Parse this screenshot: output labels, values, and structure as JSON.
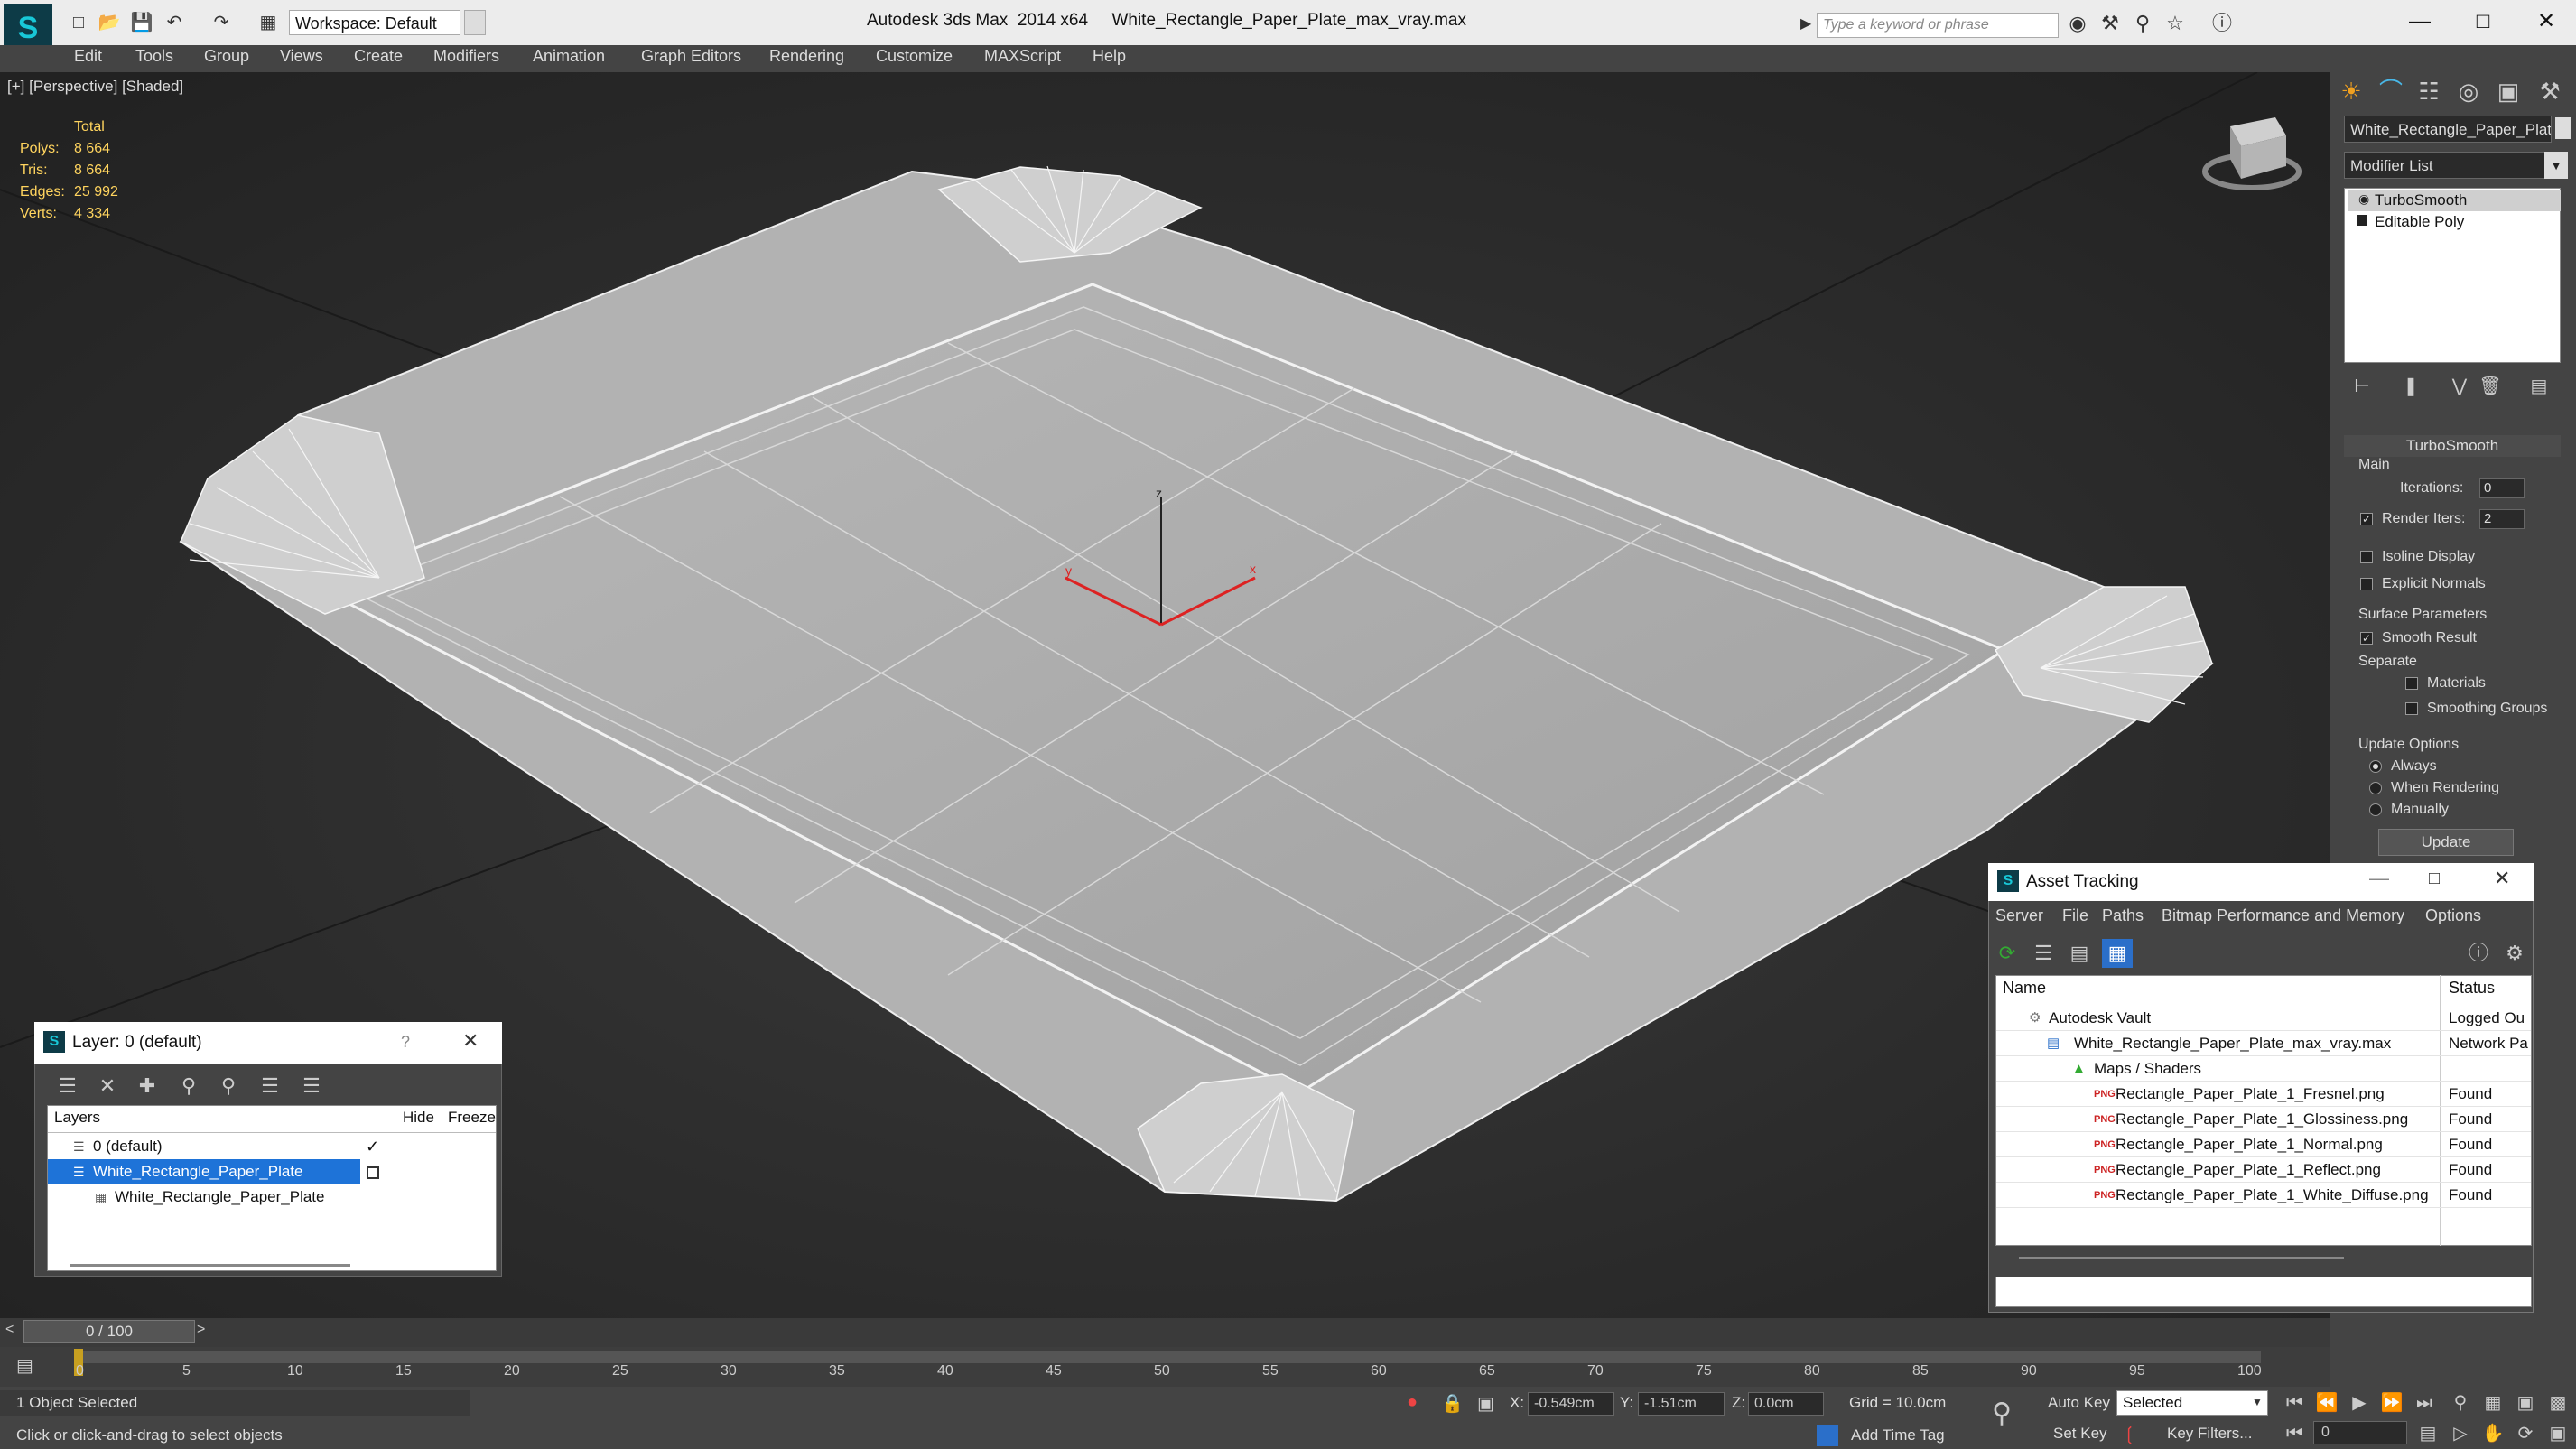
{
  "app": {
    "title": "Autodesk 3ds Max  2014 x64",
    "file": "White_Rectangle_Paper_Plate_max_vray.max",
    "workspace": "Workspace: Default",
    "search_placeholder": "Type a keyword or phrase"
  },
  "menu": [
    "Edit",
    "Tools",
    "Group",
    "Views",
    "Create",
    "Modifiers",
    "Animation",
    "Graph Editors",
    "Rendering",
    "Customize",
    "MAXScript",
    "Help"
  ],
  "viewport": {
    "label": "[+] [Perspective] [Shaded]",
    "stats": {
      "header": "Total",
      "rows": [
        {
          "label": "Polys:",
          "value": "8 664"
        },
        {
          "label": "Tris:",
          "value": "8 664"
        },
        {
          "label": "Edges:",
          "value": "25 992"
        },
        {
          "label": "Verts:",
          "value": "4 334"
        }
      ]
    },
    "axes": {
      "x": "x",
      "y": "y",
      "z": "z"
    }
  },
  "command_panel": {
    "object_name": "White_Rectangle_Paper_Plat",
    "modifier_list": "Modifier List",
    "stack": [
      "TurboSmooth",
      "Editable Poly"
    ],
    "rollout_title": "TurboSmooth",
    "main_group": "Main",
    "iterations_label": "Iterations:",
    "iterations_value": "0",
    "render_iters_label": "Render Iters:",
    "render_iters_value": "2",
    "isoline": "Isoline Display",
    "explicit_normals": "Explicit Normals",
    "surface_params": "Surface Parameters",
    "smooth_result": "Smooth Result",
    "separate": "Separate",
    "materials": "Materials",
    "smoothing_groups": "Smoothing Groups",
    "update_options": "Update Options",
    "always": "Always",
    "when_rendering": "When Rendering",
    "manually": "Manually",
    "update": "Update"
  },
  "layer_dialog": {
    "title": "Layer: 0 (default)",
    "help": "?",
    "columns": [
      "Layers",
      "Hide",
      "Freeze"
    ],
    "rows": [
      "0 (default)",
      "White_Rectangle_Paper_Plate",
      "White_Rectangle_Paper_Plate"
    ]
  },
  "asset_tracking": {
    "title": "Asset Tracking",
    "menu": [
      "Server",
      "File",
      "Paths",
      "Bitmap Performance and Memory",
      "Options"
    ],
    "columns": [
      "Name",
      "Status"
    ],
    "rows": [
      {
        "name": "Autodesk Vault",
        "status": "Logged Ou"
      },
      {
        "name": "White_Rectangle_Paper_Plate_max_vray.max",
        "status": "Network Pa"
      },
      {
        "name": "Maps / Shaders",
        "status": ""
      },
      {
        "name": "Rectangle_Paper_Plate_1_Fresnel.png",
        "status": "Found"
      },
      {
        "name": "Rectangle_Paper_Plate_1_Glossiness.png",
        "status": "Found"
      },
      {
        "name": "Rectangle_Paper_Plate_1_Normal.png",
        "status": "Found"
      },
      {
        "name": "Rectangle_Paper_Plate_1_Reflect.png",
        "status": "Found"
      },
      {
        "name": "Rectangle_Paper_Plate_1_White_Diffuse.png",
        "status": "Found"
      }
    ]
  },
  "timeline": {
    "slider": "0 / 100",
    "ticks": [
      "0",
      "5",
      "10",
      "15",
      "20",
      "25",
      "30",
      "35",
      "40",
      "45",
      "50",
      "55",
      "60",
      "65",
      "70",
      "75",
      "80",
      "85",
      "90",
      "95",
      "100"
    ]
  },
  "status": {
    "selection": "1 Object Selected",
    "prompt": "Click or click-and-drag to select objects",
    "x_label": "X:",
    "x": "-0.549cm",
    "y_label": "Y:",
    "y": "-1.51cm",
    "z_label": "Z:",
    "z": "0.0cm",
    "grid": "Grid = 10.0cm",
    "add_time_tag": "Add Time Tag",
    "auto_key": "Auto Key",
    "selected": "Selected",
    "set_key": "Set Key",
    "key_filters": "Key Filters...",
    "frame": "0"
  }
}
